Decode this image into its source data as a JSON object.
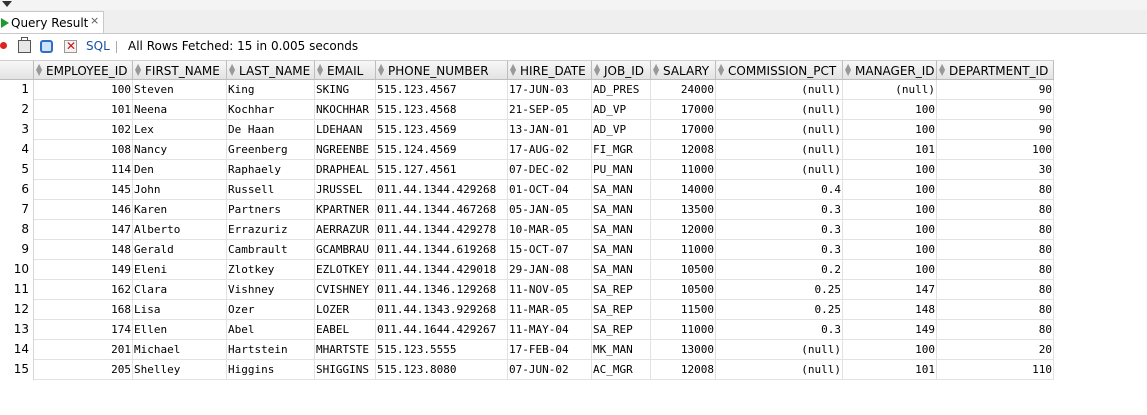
{
  "tab": {
    "label": "Query Result",
    "close": "×"
  },
  "toolbar": {
    "sql_label": "SQL",
    "status": "All Rows Fetched: 15 in 0.005 seconds"
  },
  "columns": [
    "EMPLOYEE_ID",
    "FIRST_NAME",
    "LAST_NAME",
    "EMAIL",
    "PHONE_NUMBER",
    "HIRE_DATE",
    "JOB_ID",
    "SALARY",
    "COMMISSION_PCT",
    "MANAGER_ID",
    "DEPARTMENT_ID"
  ],
  "rows": [
    {
      "n": "1",
      "c": [
        "100",
        "Steven",
        "King",
        "SKING",
        "515.123.4567",
        "17-JUN-03",
        "AD_PRES",
        "24000",
        "(null)",
        "(null)",
        "90"
      ]
    },
    {
      "n": "2",
      "c": [
        "101",
        "Neena",
        "Kochhar",
        "NKOCHHAR",
        "515.123.4568",
        "21-SEP-05",
        "AD_VP",
        "17000",
        "(null)",
        "100",
        "90"
      ]
    },
    {
      "n": "3",
      "c": [
        "102",
        "Lex",
        "De Haan",
        "LDEHAAN",
        "515.123.4569",
        "13-JAN-01",
        "AD_VP",
        "17000",
        "(null)",
        "100",
        "90"
      ]
    },
    {
      "n": "4",
      "c": [
        "108",
        "Nancy",
        "Greenberg",
        "NGREENBE",
        "515.124.4569",
        "17-AUG-02",
        "FI_MGR",
        "12008",
        "(null)",
        "101",
        "100"
      ]
    },
    {
      "n": "5",
      "c": [
        "114",
        "Den",
        "Raphaely",
        "DRAPHEAL",
        "515.127.4561",
        "07-DEC-02",
        "PU_MAN",
        "11000",
        "(null)",
        "100",
        "30"
      ]
    },
    {
      "n": "6",
      "c": [
        "145",
        "John",
        "Russell",
        "JRUSSEL",
        "011.44.1344.429268",
        "01-OCT-04",
        "SA_MAN",
        "14000",
        "0.4",
        "100",
        "80"
      ]
    },
    {
      "n": "7",
      "c": [
        "146",
        "Karen",
        "Partners",
        "KPARTNER",
        "011.44.1344.467268",
        "05-JAN-05",
        "SA_MAN",
        "13500",
        "0.3",
        "100",
        "80"
      ]
    },
    {
      "n": "8",
      "c": [
        "147",
        "Alberto",
        "Errazuriz",
        "AERRAZUR",
        "011.44.1344.429278",
        "10-MAR-05",
        "SA_MAN",
        "12000",
        "0.3",
        "100",
        "80"
      ]
    },
    {
      "n": "9",
      "c": [
        "148",
        "Gerald",
        "Cambrault",
        "GCAMBRAU",
        "011.44.1344.619268",
        "15-OCT-07",
        "SA_MAN",
        "11000",
        "0.3",
        "100",
        "80"
      ]
    },
    {
      "n": "10",
      "c": [
        "149",
        "Eleni",
        "Zlotkey",
        "EZLOTKEY",
        "011.44.1344.429018",
        "29-JAN-08",
        "SA_MAN",
        "10500",
        "0.2",
        "100",
        "80"
      ]
    },
    {
      "n": "11",
      "c": [
        "162",
        "Clara",
        "Vishney",
        "CVISHNEY",
        "011.44.1346.129268",
        "11-NOV-05",
        "SA_REP",
        "10500",
        "0.25",
        "147",
        "80"
      ]
    },
    {
      "n": "12",
      "c": [
        "168",
        "Lisa",
        "Ozer",
        "LOZER",
        "011.44.1343.929268",
        "11-MAR-05",
        "SA_REP",
        "11500",
        "0.25",
        "148",
        "80"
      ]
    },
    {
      "n": "13",
      "c": [
        "174",
        "Ellen",
        "Abel",
        "EABEL",
        "011.44.1644.429267",
        "11-MAY-04",
        "SA_REP",
        "11000",
        "0.3",
        "149",
        "80"
      ]
    },
    {
      "n": "14",
      "c": [
        "201",
        "Michael",
        "Hartstein",
        "MHARTSTE",
        "515.123.5555",
        "17-FEB-04",
        "MK_MAN",
        "13000",
        "(null)",
        "100",
        "20"
      ]
    },
    {
      "n": "15",
      "c": [
        "205",
        "Shelley",
        "Higgins",
        "SHIGGINS",
        "515.123.8080",
        "07-JUN-02",
        "AC_MGR",
        "12008",
        "(null)",
        "101",
        "110"
      ]
    }
  ]
}
